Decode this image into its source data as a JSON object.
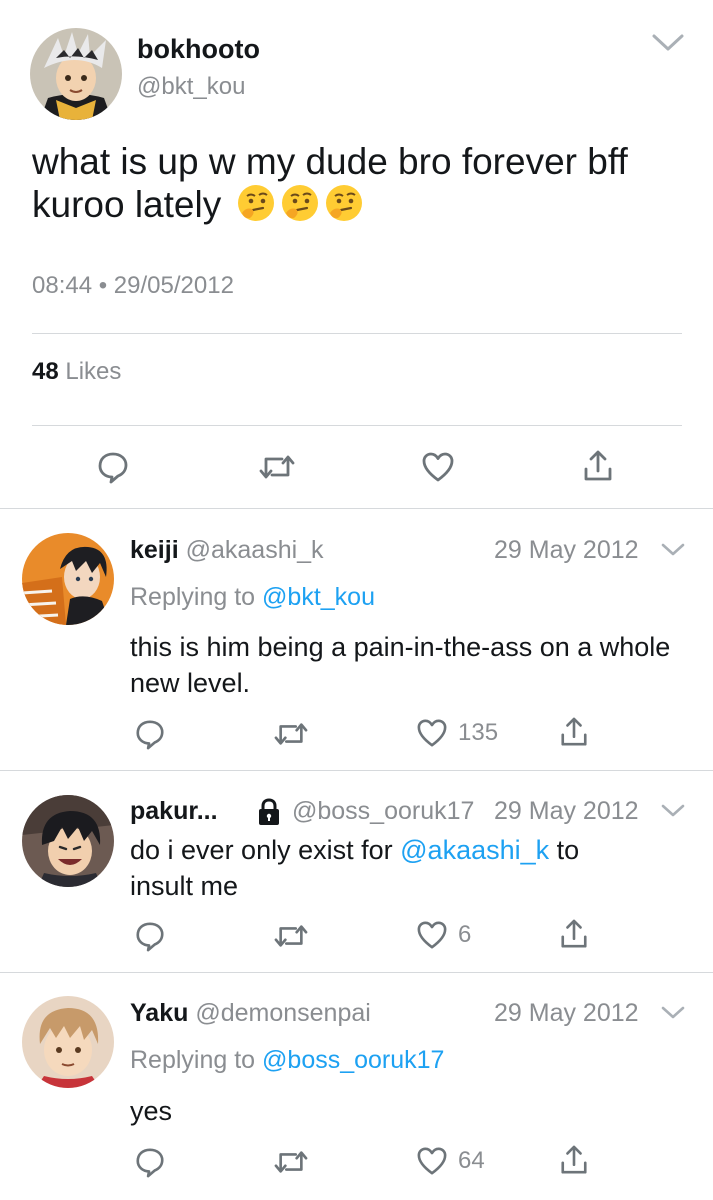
{
  "main_tweet": {
    "display_name": "bokhooto",
    "handle": "@bkt_kou",
    "text": "what is up w my dude bro forever bff kuroo lately",
    "emoji": [
      "thinking-face",
      "thinking-face",
      "thinking-face"
    ],
    "timestamp": "08:44 • 29/05/2012",
    "likes_count": "48",
    "likes_label": "Likes"
  },
  "replies": [
    {
      "display_name": "keiji",
      "handle": "@akaashi_k",
      "date": "29 May 2012",
      "replying_prefix": "Replying to",
      "replying_to": "@bkt_kou",
      "text": "this is him being a pain-in-the-ass on a whole new level.",
      "like_count": "135"
    },
    {
      "display_name": "pakur...",
      "handle": "@boss_ooruk17",
      "date": "29 May 2012",
      "protected": true,
      "text_before_mention": "do i ever only exist for",
      "mention": "@akaashi_k",
      "text_after_mention": "to",
      "text_line2": "insult me",
      "like_count": "6"
    },
    {
      "display_name": "Yaku",
      "handle": "@demonsenpai",
      "date": "29 May 2012",
      "replying_prefix": "Replying to",
      "replying_to": "@boss_ooruk17",
      "text": "yes",
      "like_count": "64"
    }
  ],
  "icons": {
    "reply": "speech-bubble-icon",
    "retweet": "retweet-icon",
    "like": "heart-icon",
    "share": "share-icon",
    "menu": "chevron-down-icon",
    "protected": "lock-icon"
  },
  "colors": {
    "link": "#1da1f2",
    "muted": "#8a8d91",
    "text": "#14171a"
  }
}
